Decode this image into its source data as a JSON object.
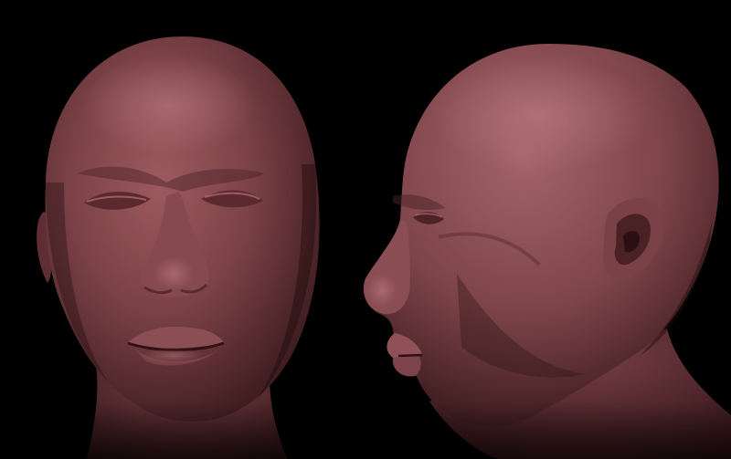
{
  "scene": {
    "background_color": "#000000",
    "material": {
      "base_color": "#7a4146",
      "highlight_color": "#a86068",
      "shadow_color": "#2a1012"
    },
    "views": [
      {
        "name": "front",
        "subject": "head-model"
      },
      {
        "name": "side",
        "subject": "head-model"
      }
    ]
  }
}
